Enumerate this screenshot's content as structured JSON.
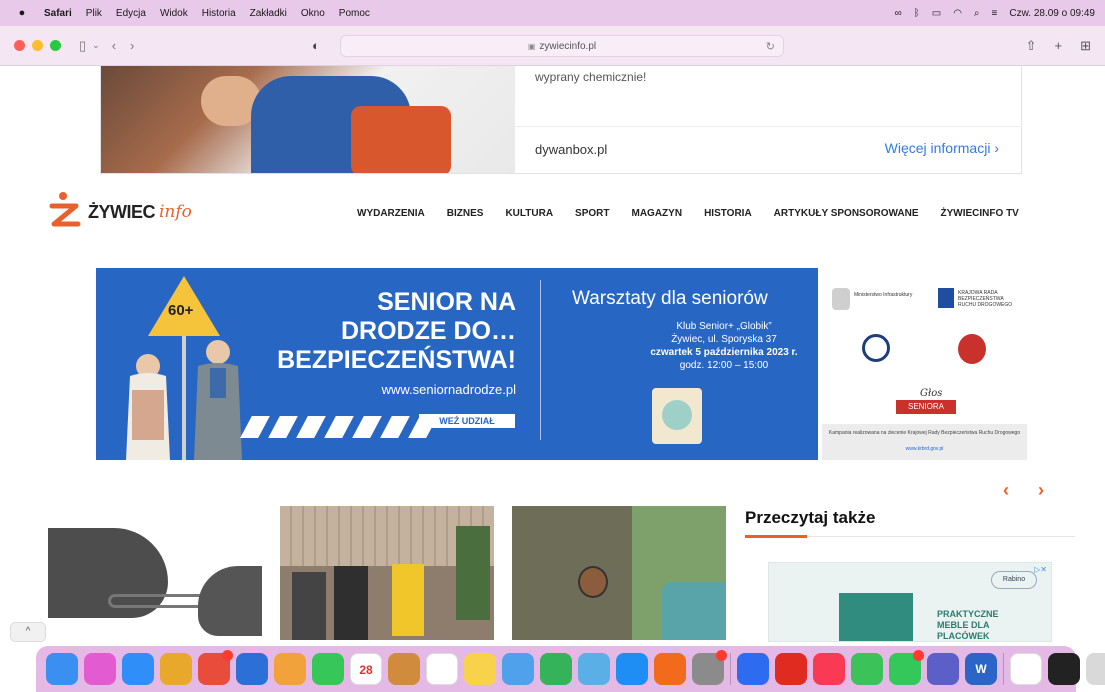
{
  "menubar": {
    "app_name": "Safari",
    "menus": [
      "Plik",
      "Edycja",
      "Widok",
      "Historia",
      "Zakładki",
      "Okno",
      "Pomoc"
    ],
    "datetime": "Czw. 28.09 o 09:49",
    "status_icons": [
      "creative-cloud-icon",
      "bluetooth-icon",
      "battery-icon",
      "wifi-icon",
      "spotlight-icon",
      "control-center-icon"
    ]
  },
  "toolbar": {
    "url": "zywiecinfo.pl"
  },
  "ad_top": {
    "text": "wyprany chemicznie!",
    "site": "dywanbox.pl",
    "cta": "Więcej informacji",
    "cta_arrow": "›"
  },
  "site": {
    "logo_main": "ŻYWIEC",
    "logo_sub": "info",
    "accent_color": "#e8612c",
    "nav": [
      "WYDARZENIA",
      "BIZNES",
      "KULTURA",
      "SPORT",
      "MAGAZYN",
      "HISTORIA",
      "ARTYKUŁY SPONSOROWANE",
      "ŻYWIECINFO TV"
    ]
  },
  "senior_banner": {
    "sign": "60+",
    "headline_1": "SENIOR NA",
    "headline_2": "DRODZE DO…",
    "headline_3": "BEZPIECZEŃSTWA!",
    "url": "www.seniornadrodze.pl",
    "button": "WEŹ UDZIAŁ",
    "title": "Warsztaty dla seniorów",
    "line_1": "Klub Senior+ „Globik”",
    "line_2": "Żywiec, ul. Sporyska 37",
    "line_3": "czwartek 5 października 2023 r.",
    "line_4": "godz. 12:00 – 15:00",
    "partner_1": "Ministerstwo Infrastruktury",
    "partner_2": "KRAJOWA RADA BEZPIECZEŃSTWA RUCHU DROGOWEGO",
    "partner_3": "Głos",
    "partner_4": "SENIORA",
    "foot_text": "Kampania realizowana na zlecenie Krajowej Rady Bezpieczeństwa Ruchu Drogowego",
    "foot_link": "www.krbrd.gov.pl",
    "bg_color": "#2866c4"
  },
  "carousel": {
    "prev": "‹",
    "next": "›"
  },
  "sidebar": {
    "title": "Przeczytaj także",
    "ad_text_1": "PRAKTYCZNE",
    "ad_text_2": "MEBLE DLA",
    "ad_text_3": "PLACÓWEK",
    "ad_brand": "Rabino"
  },
  "scroll_up": "^",
  "dock": {
    "apps": [
      {
        "name": "finder",
        "color": "#3b8ff0",
        "label": ""
      },
      {
        "name": "launchpad",
        "color": "#e35bd1",
        "label": ""
      },
      {
        "name": "safari",
        "color": "#2f8ef7",
        "label": ""
      },
      {
        "name": "chrome",
        "color": "#e8a82c",
        "label": ""
      },
      {
        "name": "sync",
        "color": "#e84d3c",
        "label": ""
      },
      {
        "name": "sourcetree",
        "color": "#2c6fd6",
        "label": ""
      },
      {
        "name": "photos",
        "color": "#f2a23a",
        "label": ""
      },
      {
        "name": "facetime",
        "color": "#37c659",
        "label": ""
      },
      {
        "name": "calendar",
        "color": "#ffffff",
        "label": "28"
      },
      {
        "name": "notes-brown",
        "color": "#d18b3d",
        "label": ""
      },
      {
        "name": "reminders",
        "color": "#ffffff",
        "label": ""
      },
      {
        "name": "notes",
        "color": "#f8d24a",
        "label": ""
      },
      {
        "name": "keynote",
        "color": "#4ea1ea",
        "label": ""
      },
      {
        "name": "numbers",
        "color": "#34b35a",
        "label": ""
      },
      {
        "name": "preview",
        "color": "#5ab0e6",
        "label": ""
      },
      {
        "name": "app-store",
        "color": "#1e8ef5",
        "label": ""
      },
      {
        "name": "firefox",
        "color": "#f26a1b",
        "label": ""
      },
      {
        "name": "settings",
        "color": "#8b8b8b",
        "label": ""
      },
      {
        "name": "zoom",
        "color": "#2d6cf0",
        "label": ""
      },
      {
        "name": "acrobat",
        "color": "#e02b20",
        "label": ""
      },
      {
        "name": "music",
        "color": "#fa3a55",
        "label": ""
      },
      {
        "name": "evernote",
        "color": "#3bc35a",
        "label": ""
      },
      {
        "name": "messages",
        "color": "#34c759",
        "label": ""
      },
      {
        "name": "teams",
        "color": "#5b5fc7",
        "label": ""
      },
      {
        "name": "word",
        "color": "#2b65c8",
        "label": "W"
      },
      {
        "name": "document",
        "color": "#ffffff",
        "label": ""
      },
      {
        "name": "terminal",
        "color": "#222222",
        "label": ""
      },
      {
        "name": "trash",
        "color": "#d9d9d9",
        "label": ""
      }
    ]
  }
}
